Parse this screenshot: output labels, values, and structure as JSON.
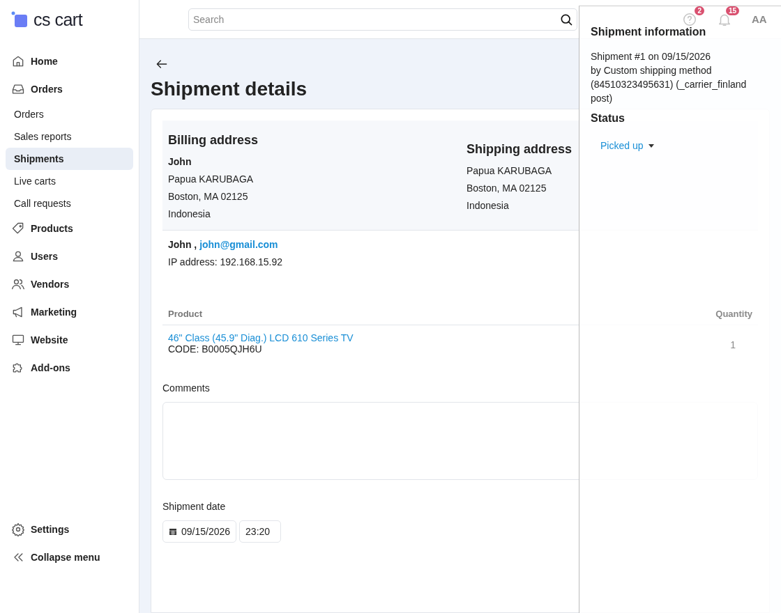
{
  "brand": {
    "name": "cs cart"
  },
  "sidebar": {
    "items": [
      {
        "label": "Home",
        "kind": "section",
        "selected": false
      },
      {
        "label": "Orders",
        "kind": "section",
        "selected": false
      },
      {
        "label": "Orders",
        "kind": "sub",
        "selected": false
      },
      {
        "label": "Sales reports",
        "kind": "sub",
        "selected": false
      },
      {
        "label": "Shipments",
        "kind": "sub",
        "selected": true
      },
      {
        "label": "Live carts",
        "kind": "sub",
        "selected": false
      },
      {
        "label": "Call requests",
        "kind": "sub",
        "selected": false
      },
      {
        "label": "Products",
        "kind": "section",
        "selected": false
      },
      {
        "label": "Users",
        "kind": "section",
        "selected": false
      },
      {
        "label": "Vendors",
        "kind": "section",
        "selected": false
      },
      {
        "label": "Marketing",
        "kind": "section",
        "selected": false
      },
      {
        "label": "Website",
        "kind": "section",
        "selected": false
      },
      {
        "label": "Add-ons",
        "kind": "section",
        "selected": false
      }
    ],
    "footer": [
      {
        "label": "Settings"
      },
      {
        "label": "Collapse menu"
      }
    ]
  },
  "header": {
    "search": {
      "placeholder": "Search"
    },
    "help_badge": "2",
    "notifications_badge": "15",
    "user_initials": "AA"
  },
  "page": {
    "title": "Shipment details",
    "billing": {
      "heading": "Billing address",
      "name": "John",
      "lines": [
        "Papua KARUBAGA",
        "Boston, MA 02125",
        "Indonesia"
      ]
    },
    "shipping": {
      "heading": "Shipping address",
      "lines": [
        "Papua KARUBAGA",
        "Boston, MA 02125",
        "Indonesia"
      ]
    },
    "customer": {
      "name": "John ,",
      "email": "john@gmail.com"
    },
    "ip": "IP address: 192.168.15.92",
    "table": {
      "columns": [
        "Product",
        "Quantity"
      ],
      "rows": [
        {
          "product": "46\" Class (45.9\" Diag.) LCD 610 Series TV",
          "code": "CODE: B0005QJH6U",
          "quantity": "1"
        }
      ]
    },
    "comments": {
      "label": "Comments"
    },
    "shipment_date": {
      "label": "Shipment date",
      "date": "09/15/2026",
      "time": "23:20"
    }
  },
  "drawer": {
    "title": "Shipment information",
    "lines": [
      "Shipment #1 on 09/15/2026",
      "by Custom shipping method",
      "(84510323495631) (_carrier_finland post)"
    ],
    "status_label": "Status",
    "status": "Picked up"
  }
}
